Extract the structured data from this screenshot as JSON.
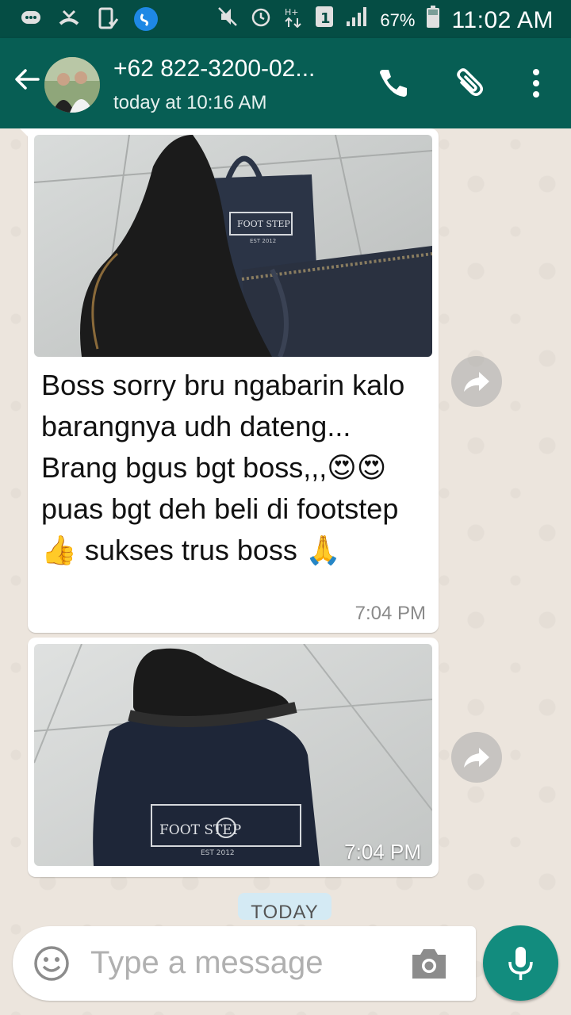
{
  "status_bar": {
    "battery": "67%",
    "time": "11:02 AM",
    "icons": [
      "chat-bubble-icon",
      "missed-call-icon",
      "phone-check-icon",
      "shazam-icon",
      "mute-icon",
      "alarm-icon",
      "data-arrows-icon",
      "sim-1-icon",
      "signal-icon",
      "battery-icon"
    ]
  },
  "header": {
    "contact_name": "+62 822-3200-02...",
    "last_seen": "today at 10:16 AM",
    "back_icon": "arrow-back-icon",
    "call_icon": "phone-icon",
    "attach_icon": "paperclip-icon",
    "menu_icon": "more-vert-icon"
  },
  "messages": [
    {
      "type": "image_with_caption",
      "caption_parts": [
        "Boss sorry bru ngabarin kalo barangnya udh dateng...                 Brang bgus bgt boss,,,",
        "😍😍",
        "puas bgt deh beli di footstep ",
        "👍",
        " sukses trus boss ",
        "🙏"
      ],
      "time": "7:04 PM",
      "photo_label": "FOOT STEP",
      "photo_sublabel": "EST 2012"
    },
    {
      "type": "image",
      "time": "7:04 PM",
      "photo_label": "FOOT STEP",
      "photo_sublabel": "EST 2012"
    }
  ],
  "date_chip": "TODAY",
  "composer": {
    "placeholder": "Type a message",
    "emoji_icon": "smiley-icon",
    "camera_icon": "camera-icon",
    "mic_icon": "mic-icon"
  },
  "colors": {
    "app_bar": "#075e54",
    "status_bar": "#054d44",
    "fab": "#128c7e",
    "chat_bg": "#ece5dd"
  }
}
